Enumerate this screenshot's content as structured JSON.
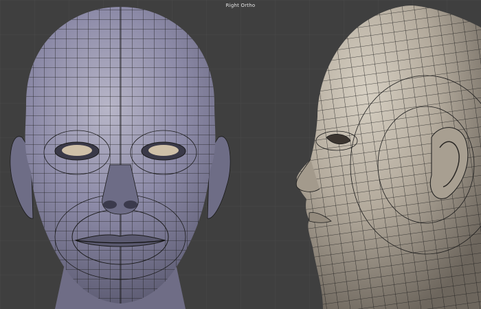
{
  "viewport": {
    "view_label": "Right Ortho",
    "background_color": "#3f3f3f",
    "grid_color": "#4a4a4a",
    "mesh_wire_color": "#1a1a1a"
  },
  "models": [
    {
      "name": "head-front-view",
      "shading": "lavender-grey"
    },
    {
      "name": "head-side-view",
      "shading": "warm-beige"
    }
  ]
}
